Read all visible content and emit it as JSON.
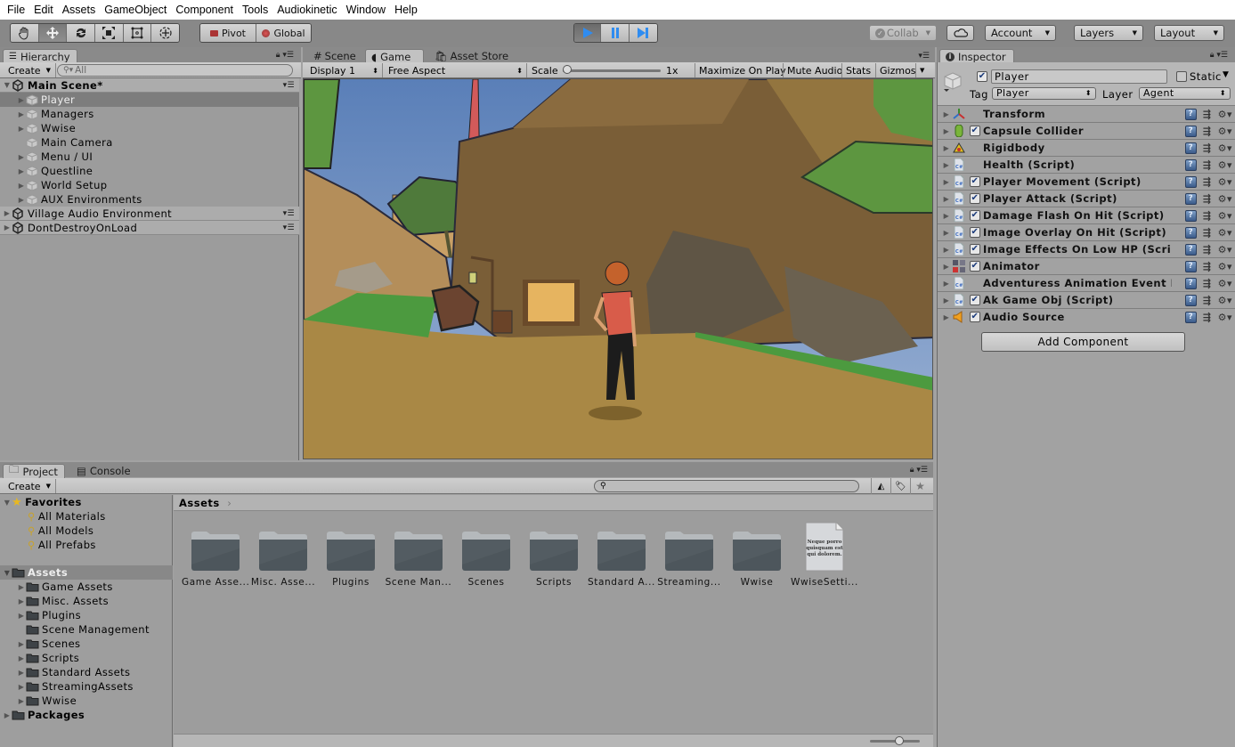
{
  "menu": [
    "File",
    "Edit",
    "Assets",
    "GameObject",
    "Component",
    "Tools",
    "Audiokinetic",
    "Window",
    "Help"
  ],
  "toolbar": {
    "tools": [
      "hand-tool",
      "move-tool",
      "rotate-tool",
      "scale-tool",
      "rect-tool",
      "transform-tool"
    ],
    "pivot_label": "Pivot",
    "global_label": "Global",
    "collab_label": "Collab",
    "account_label": "Account",
    "layers_label": "Layers",
    "layout_label": "Layout"
  },
  "hierarchy": {
    "tab_label": "Hierarchy",
    "create_label": "Create",
    "search_placeholder": "All",
    "scenes": [
      {
        "name": "Main Scene*",
        "expanded": true,
        "children": [
          {
            "name": "Player",
            "has_children": true,
            "selected": true
          },
          {
            "name": "Managers",
            "has_children": true
          },
          {
            "name": "Wwise",
            "has_children": true
          },
          {
            "name": "Main Camera",
            "has_children": false
          },
          {
            "name": "Menu / UI",
            "has_children": true
          },
          {
            "name": "Questline",
            "has_children": true
          },
          {
            "name": "World Setup",
            "has_children": true
          },
          {
            "name": "AUX Environments",
            "has_children": true
          }
        ]
      },
      {
        "name": "Village Audio Environment",
        "expanded": false
      },
      {
        "name": "DontDestroyOnLoad",
        "expanded": false
      }
    ]
  },
  "game": {
    "tabs": [
      "Scene",
      "Game",
      "Asset Store"
    ],
    "active_tab": "Game",
    "display": "Display 1",
    "aspect": "Free Aspect",
    "scale_label": "Scale",
    "scale_value": "1x",
    "scale_fraction": 0.0,
    "maximize_on_play": "Maximize On Play",
    "mute_audio": "Mute Audio",
    "stats": "Stats",
    "gizmos": "Gizmos"
  },
  "inspector": {
    "tab_label": "Inspector",
    "object_name": "Player",
    "object_active": true,
    "static_label": "Static",
    "static_checked": false,
    "tag_label": "Tag",
    "tag_value": "Player",
    "layer_label": "Layer",
    "layer_value": "Agent",
    "components": [
      {
        "name": "Transform",
        "icon": "transform-icon",
        "has_checkbox": false
      },
      {
        "name": "Capsule Collider",
        "icon": "capsule-collider-icon",
        "has_checkbox": true,
        "enabled": true
      },
      {
        "name": "Rigidbody",
        "icon": "rigidbody-icon",
        "has_checkbox": false
      },
      {
        "name": "Health (Script)",
        "icon": "csharp-script-icon",
        "has_checkbox": false
      },
      {
        "name": "Player Movement (Script)",
        "icon": "csharp-script-icon",
        "has_checkbox": true,
        "enabled": true
      },
      {
        "name": "Player Attack (Script)",
        "icon": "csharp-script-icon",
        "has_checkbox": true,
        "enabled": true
      },
      {
        "name": "Damage Flash On Hit (Script)",
        "icon": "csharp-script-icon",
        "has_checkbox": true,
        "enabled": true
      },
      {
        "name": "Image Overlay On Hit (Script)",
        "icon": "csharp-script-icon",
        "has_checkbox": true,
        "enabled": true
      },
      {
        "name": "Image Effects On Low HP (Script",
        "icon": "csharp-script-icon",
        "has_checkbox": true,
        "enabled": true
      },
      {
        "name": "Animator",
        "icon": "animator-icon",
        "has_checkbox": true,
        "enabled": true
      },
      {
        "name": "Adventuress Animation Event Ha",
        "icon": "csharp-script-icon",
        "has_checkbox": false
      },
      {
        "name": "Ak Game Obj (Script)",
        "icon": "csharp-script-icon",
        "has_checkbox": true,
        "enabled": true
      },
      {
        "name": "Audio Source",
        "icon": "audio-source-icon",
        "has_checkbox": true,
        "enabled": true
      }
    ],
    "add_component_label": "Add Component"
  },
  "project": {
    "tabs": [
      "Project",
      "Console"
    ],
    "active_tab": "Project",
    "create_label": "Create",
    "favorites_label": "Favorites",
    "favorites": [
      "All Materials",
      "All Models",
      "All Prefabs"
    ],
    "assets_label": "Assets",
    "asset_folders": [
      {
        "name": "Game Assets",
        "has_children": true
      },
      {
        "name": "Misc. Assets",
        "has_children": true
      },
      {
        "name": "Plugins",
        "has_children": true
      },
      {
        "name": "Scene Management",
        "has_children": false
      },
      {
        "name": "Scenes",
        "has_children": true
      },
      {
        "name": "Scripts",
        "has_children": true
      },
      {
        "name": "Standard Assets",
        "has_children": true
      },
      {
        "name": "StreamingAssets",
        "has_children": true
      },
      {
        "name": "Wwise",
        "has_children": true
      }
    ],
    "packages_label": "Packages",
    "breadcrumb": "Assets",
    "grid_items": [
      {
        "label": "Game Asse...",
        "type": "folder"
      },
      {
        "label": "Misc. Asse...",
        "type": "folder"
      },
      {
        "label": "Plugins",
        "type": "folder"
      },
      {
        "label": "Scene Man...",
        "type": "folder"
      },
      {
        "label": "Scenes",
        "type": "folder"
      },
      {
        "label": "Scripts",
        "type": "folder"
      },
      {
        "label": "Standard A...",
        "type": "folder"
      },
      {
        "label": "Streaming...",
        "type": "folder"
      },
      {
        "label": "Wwise",
        "type": "folder"
      },
      {
        "label": "WwiseSetti...",
        "type": "file",
        "preview_text": "Neque porro quisquam est qui dolorem."
      }
    ],
    "zoom_fraction": 0.6
  },
  "colors": {
    "play_accent": "#2f8cf0",
    "selected_row": "#7d7d7d",
    "panel_bg": "#a2a2a2"
  }
}
